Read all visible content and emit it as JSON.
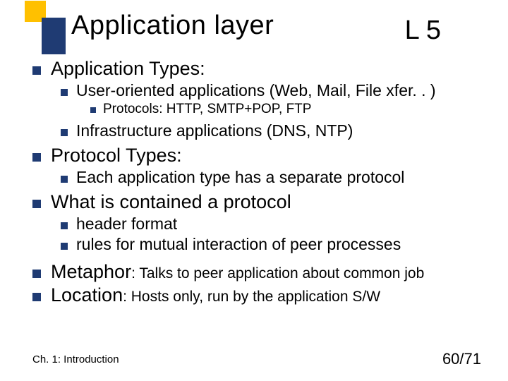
{
  "title": {
    "main": "Application layer",
    "right": "L 5"
  },
  "bullets": {
    "appTypes": "Application Types:",
    "userApps": "User-oriented applications (Web, Mail, File xfer. . )",
    "protocols": "Protocols: HTTP, SMTP+POP, FTP",
    "infra": "Infrastructure applications (DNS, NTP)",
    "protoTypes": "Protocol Types:",
    "eachApp": "Each application type has a separate protocol",
    "contained": "What is contained a protocol",
    "header": "header format",
    "rules": "rules for mutual interaction of peer processes",
    "metaphorLabel": "Metaphor",
    "metaphorText": ": Talks to peer application about common job",
    "locationLabel": "Location",
    "locationText": ": Hosts only, run by the application S/W"
  },
  "footer": {
    "left": "Ch. 1: Introduction",
    "right": "60/71"
  }
}
